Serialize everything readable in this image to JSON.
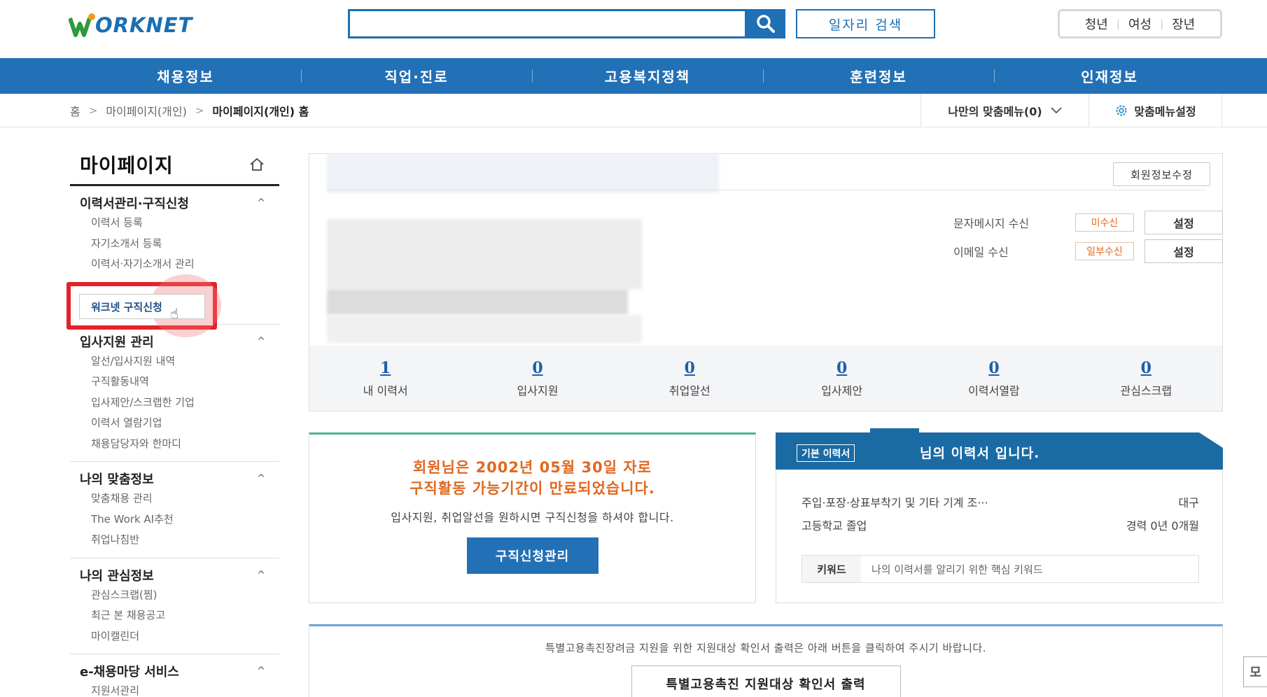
{
  "header": {
    "logo_text": "ORKNET",
    "job_search_label": "일자리 검색",
    "age_links": [
      "청년",
      "여성",
      "장년"
    ]
  },
  "gnb": [
    "채용정보",
    "직업·진로",
    "고용복지정책",
    "훈련정보",
    "인재정보"
  ],
  "breadcrumb": {
    "home": "홈",
    "level1": "마이페이지(개인)",
    "current": "마이페이지(개인) 홈",
    "arrow": ">"
  },
  "my_menu": {
    "label": "나만의 맞춤메뉴(0)",
    "settings_label": "맞춤메뉴설정"
  },
  "lnb": {
    "title": "마이페이지",
    "groups": [
      {
        "title": "이력서관리·구직신청",
        "chevron": "^",
        "items": [
          "이력서 등록",
          "자기소개서 등록",
          "이력서·자기소개서 관리",
          "워크넷 구직신청"
        ]
      },
      {
        "title": "입사지원 관리",
        "chevron": "^",
        "items": [
          "알선/입사지원 내역",
          "구직활동내역",
          "입사제안/스크랩한 기업",
          "이력서 열람기업",
          "채용담당자와 한마디"
        ]
      },
      {
        "title": "나의 맞춤정보",
        "chevron": "^",
        "items": [
          "맞춤채용 관리",
          "The Work AI추천",
          "취업나침반"
        ]
      },
      {
        "title": "나의 관심정보",
        "chevron": "^",
        "items": [
          "관심스크랩(찜)",
          "최근 본 채용공고",
          "마이캘린더"
        ]
      },
      {
        "title": "e-채용마당 서비스",
        "chevron": "^",
        "items": [
          "지원서관리"
        ]
      }
    ]
  },
  "profile": {
    "edit_button": "회원정보수정",
    "prefs": [
      {
        "label": "문자메시지 수신",
        "status": "미수신",
        "button": "설정"
      },
      {
        "label": "이메일 수신",
        "status": "일부수신",
        "button": "설정"
      }
    ],
    "stats": [
      {
        "value": "1",
        "label": "내 이력서"
      },
      {
        "value": "0",
        "label": "입사지원"
      },
      {
        "value": "0",
        "label": "취업알선"
      },
      {
        "value": "0",
        "label": "입사제안"
      },
      {
        "value": "0",
        "label": "이력서열람"
      },
      {
        "value": "0",
        "label": "관심스크랩"
      }
    ]
  },
  "notice": {
    "line1": "회원님은 2002년 05월 30일 자로",
    "line2": "구직활동 가능기간이 만료되었습니다.",
    "desc": "입사지원, 취업알선을 원하시면 구직신청을 하셔야 합니다.",
    "button": "구직신청관리"
  },
  "resume": {
    "badge": "기본 이력서",
    "title": "님의 이력서 입니다.",
    "job": "주입·포장·상표부착기 및 기타 기계 조···",
    "region": "대구",
    "education": "고등학교 졸업",
    "career": "경력 0년 0개월",
    "keyword_label": "키워드",
    "keyword_placeholder": "나의 이력서를 알리기 위한 핵심 키워드"
  },
  "bottom": {
    "text": "특별고용촉진장려금 지원을 위한 지원대상 확인서 출력은 아래 버튼을 클릭하여 주시기 바랍니다.",
    "button": "특별고용촉진 지원대상 확인서 출력"
  },
  "side_float": "모",
  "colors": {
    "brand_blue": "#2270b6",
    "accent_orange": "#e06820",
    "highlight_red": "#e5212b",
    "resume_header": "#1a6aa4"
  },
  "icons": {
    "search": "search-icon",
    "home": "home-icon",
    "gear": "gear-icon",
    "chevron": "chevron-down-icon",
    "cursor": "hand-cursor-icon"
  }
}
